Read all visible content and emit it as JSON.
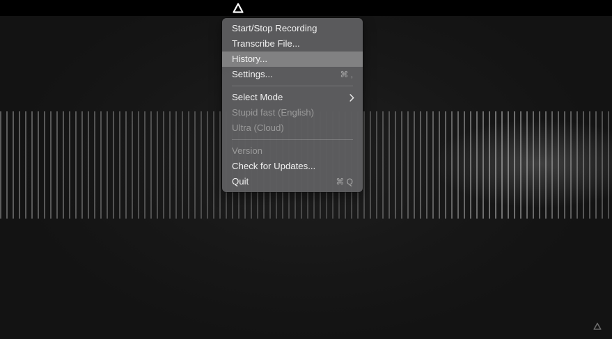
{
  "app": {
    "icon": "triangle-logo-icon"
  },
  "menu": {
    "items": [
      {
        "label": "Start/Stop Recording"
      },
      {
        "label": "Transcribe File..."
      },
      {
        "label": "History..."
      },
      {
        "label": "Settings...",
        "shortcut": "⌘ ,"
      },
      {
        "label": "Select Mode",
        "submenu_icon": "chevron-right-icon"
      },
      {
        "label": "Stupid fast (English)"
      },
      {
        "label": "Ultra (Cloud)"
      },
      {
        "label": "Version"
      },
      {
        "label": "Check for Updates..."
      },
      {
        "label": "Quit",
        "shortcut": "⌘ Q"
      }
    ],
    "highlighted_item": "History..."
  },
  "colors": {
    "menubar": "#000000",
    "menu_bg": "#5e5e60",
    "highlight": "#8a8a8a",
    "text": "#f2f2f2",
    "disabled_text": "#9a9a9a"
  }
}
